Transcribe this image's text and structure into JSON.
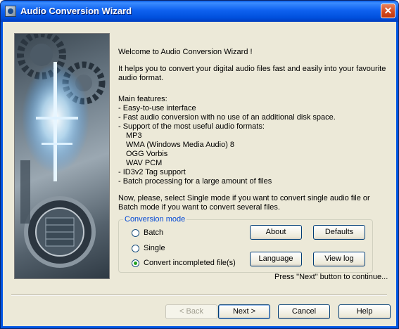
{
  "window": {
    "title": "Audio Conversion Wizard"
  },
  "intro": {
    "welcome": "Welcome to Audio Conversion Wizard !",
    "desc_line1": "It helps you to convert your digital audio files fast and easily into your favourite",
    "desc_line2": "audio format.",
    "features_heading": "Main features:",
    "features": [
      "- Easy-to-use interface",
      "- Fast audio conversion with no use of an additional disk space.",
      "- Support of the most useful audio formats:",
      "MP3",
      "WMA (Windows Media Audio) 8",
      "OGG Vorbis",
      "WAV PCM",
      "- ID3v2 Tag support",
      "- Batch processing for a large amount of files"
    ],
    "prompt_line1": "Now, please, select Single mode if you want to convert single audio file or",
    "prompt_line2": "Batch mode if you want to convert several files."
  },
  "conversion_mode": {
    "legend": "Conversion mode",
    "options": [
      {
        "label": "Batch",
        "checked": false
      },
      {
        "label": "Single",
        "checked": false
      },
      {
        "label": "Convert incompleted file(s)",
        "checked": true
      }
    ]
  },
  "buttons": {
    "about": "About",
    "defaults": "Defaults",
    "language": "Language",
    "view_log": "View log",
    "back": "< Back",
    "next": "Next >",
    "cancel": "Cancel",
    "help": "Help"
  },
  "hint": "Press \"Next\" button to continue..."
}
